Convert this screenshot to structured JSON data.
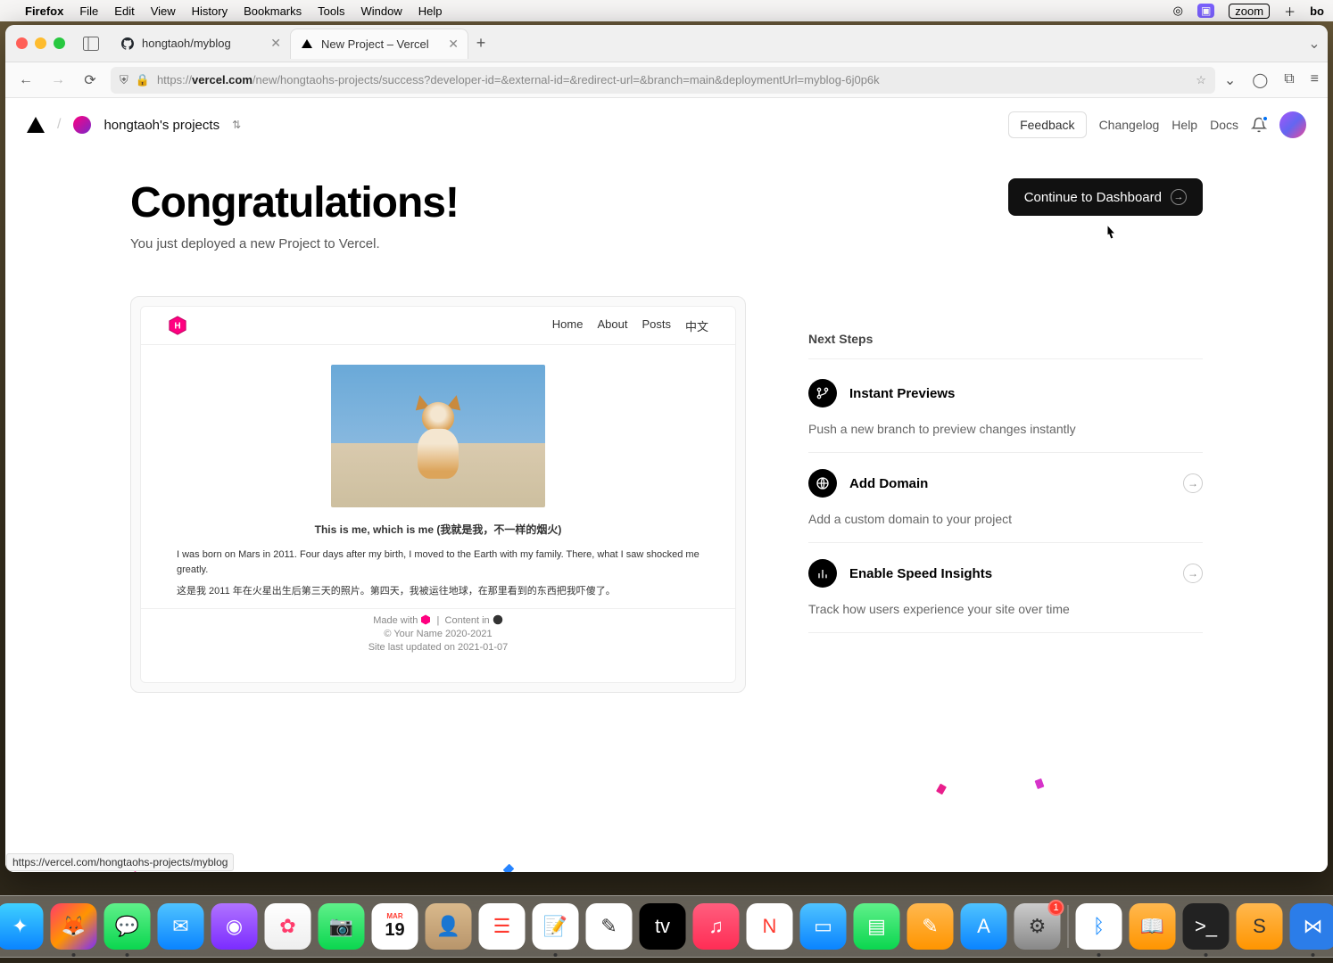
{
  "menubar": {
    "app": "Firefox",
    "items": [
      "File",
      "Edit",
      "View",
      "History",
      "Bookmarks",
      "Tools",
      "Window",
      "Help"
    ],
    "zoom": "zoom"
  },
  "tabs": [
    {
      "title": "hongtaoh/myblog",
      "favicon": "github"
    },
    {
      "title": "New Project – Vercel",
      "favicon": "vercel"
    }
  ],
  "url": {
    "prefix": "https://",
    "host": "vercel.com",
    "path": "/new/hongtaohs-projects/success?developer-id=&external-id=&redirect-url=&branch=main&deploymentUrl=myblog-6j0p6k"
  },
  "vercel": {
    "project_scope": "hongtaoh's projects",
    "nav": {
      "feedback": "Feedback",
      "changelog": "Changelog",
      "help": "Help",
      "docs": "Docs"
    }
  },
  "hero": {
    "title": "Congratulations!",
    "subtitle": "You just deployed a new Project to Vercel.",
    "cta": "Continue to Dashboard"
  },
  "preview": {
    "nav": [
      "Home",
      "About",
      "Posts",
      "中文"
    ],
    "caption": "This is me, which is me (我就是我，不一样的烟火)",
    "para1": "I was born on Mars in 2011. Four days after my birth, I moved to the Earth with my family. There, what I saw shocked me greatly.",
    "para2": "这是我 2011 年在火星出生后第三天的照片。第四天，我被运往地球，在那里看到的东西把我吓傻了。",
    "footer": {
      "made": "Made with",
      "content": "Content in",
      "copyright": "© Your Name 2020-2021",
      "updated": "Site last updated on 2021-01-07"
    }
  },
  "steps": {
    "heading": "Next Steps",
    "items": [
      {
        "title": "Instant Previews",
        "desc": "Push a new branch to preview changes instantly",
        "icon": "branch",
        "link": false
      },
      {
        "title": "Add Domain",
        "desc": "Add a custom domain to your project",
        "icon": "globe",
        "link": true
      },
      {
        "title": "Enable Speed Insights",
        "desc": "Track how users experience your site over time",
        "icon": "bars",
        "link": true
      }
    ]
  },
  "statusbar": "https://vercel.com/hongtaohs-projects/myblog",
  "dock": {
    "settings_badge": "1",
    "cal_month": "MAR",
    "cal_day": "19"
  }
}
